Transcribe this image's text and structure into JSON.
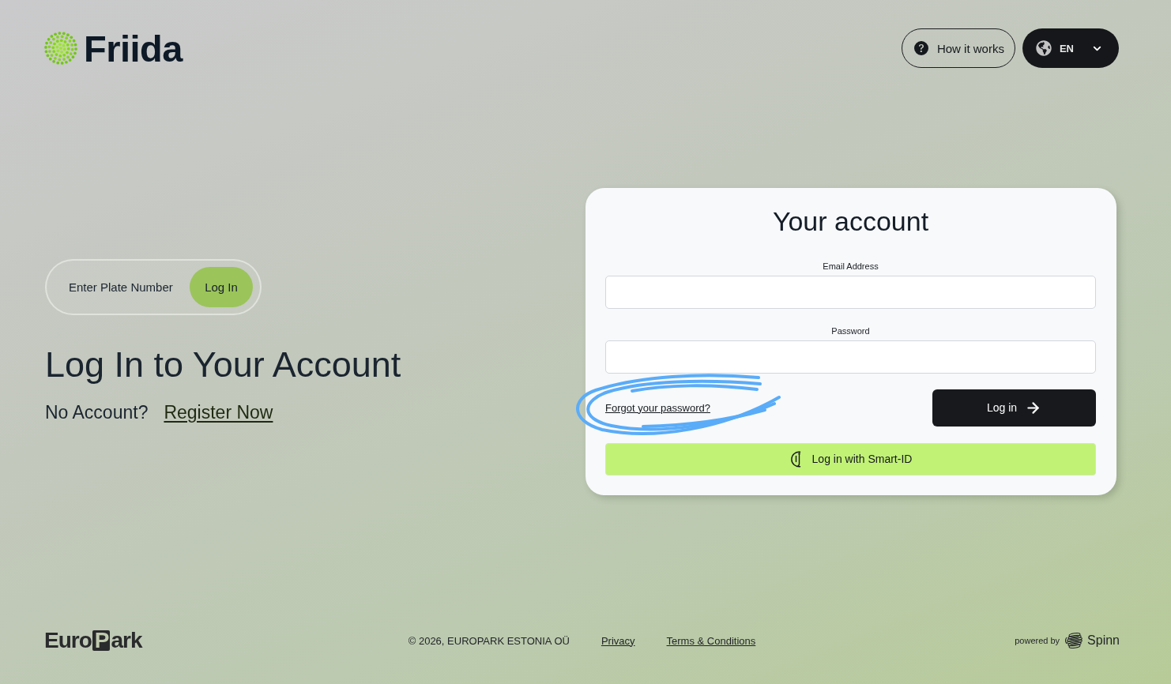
{
  "header": {
    "logo": {
      "text": "Friida"
    },
    "how_it_works": {
      "label": "How it works"
    },
    "language": {
      "label": "EN"
    }
  },
  "plate_login": {
    "placeholder": "Enter Plate Number",
    "button": "Log In"
  },
  "heading": "Log In to Your Account",
  "register": {
    "prompt": "No Account?",
    "link": "Register Now"
  },
  "account_card": {
    "title": "Your account",
    "fields": [
      {
        "label": "Email Address"
      },
      {
        "label": "Password"
      }
    ],
    "forgot_link": {
      "label": "Forgot your password?",
      "annotated": true
    },
    "login_button": "Log in",
    "smart_id_button": "Log in with Smart-ID"
  },
  "footer": {
    "brand": {
      "before": "Euro",
      "boxed": "P",
      "after": "ark"
    },
    "copyright": "© 2026, EUROPARK ESTONIA OÜ",
    "links": [
      "Privacy",
      "Terms & Conditions"
    ],
    "powered_by": {
      "label": "powered by",
      "brand": "Spinn"
    }
  }
}
